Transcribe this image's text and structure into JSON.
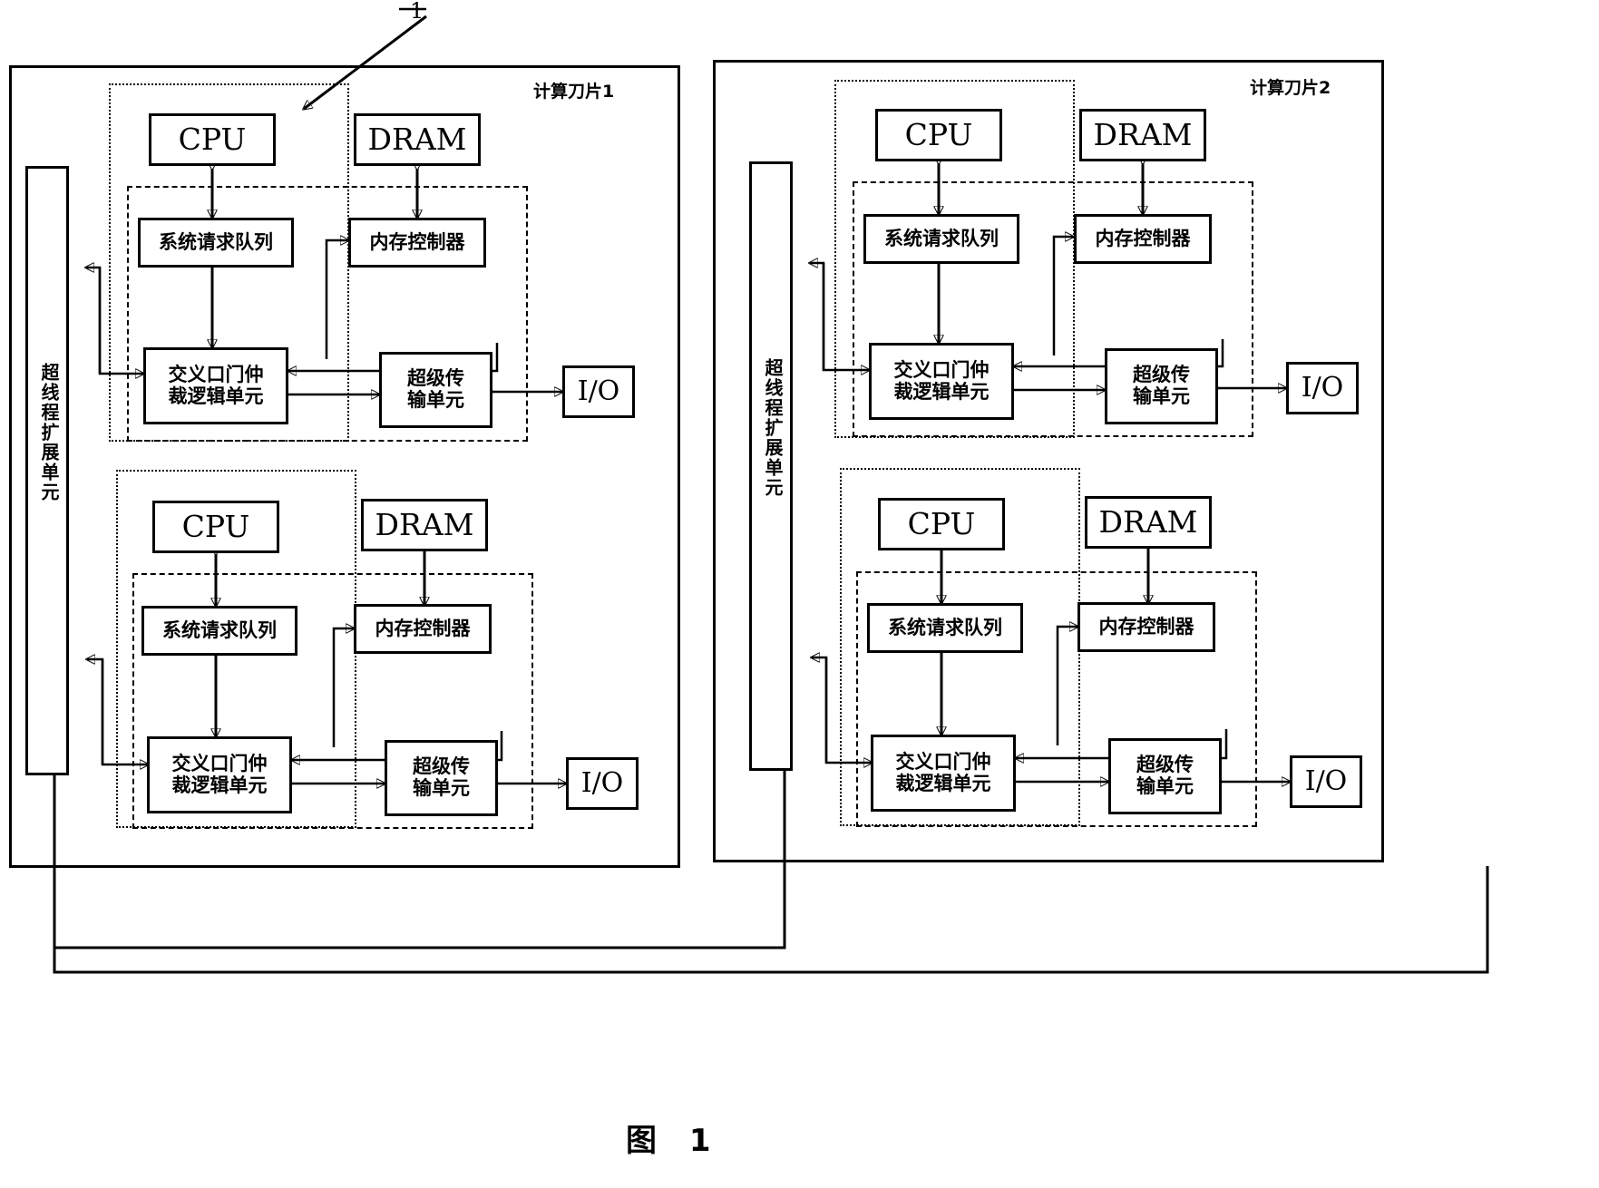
{
  "figure": {
    "caption": "图  1",
    "callout_number": "1"
  },
  "blades": [
    {
      "id": "blade-1",
      "label": "计算刀片1",
      "hyperthread_unit": "超线程扩展单元",
      "nodes": [
        {
          "id": "node-1",
          "cpu": "CPU",
          "dram": "DRAM",
          "request_queue": "系统请求队列",
          "memory_controller": "内存控制器",
          "crossbar": "交叉口门仲裁逻辑单元",
          "hypertransport": "超级传输单元",
          "io": "I/O"
        },
        {
          "id": "node-2",
          "cpu": "CPU",
          "dram": "DRAM",
          "request_queue": "系统请求队列",
          "memory_controller": "内存控制器",
          "crossbar": "交叉口门仲裁逻辑单元",
          "hypertransport": "超级传输单元",
          "io": "I/O"
        }
      ]
    },
    {
      "id": "blade-2",
      "label": "计算刀片2",
      "hyperthread_unit": "超线程扩展单元",
      "nodes": [
        {
          "id": "node-1",
          "cpu": "CPU",
          "dram": "DRAM",
          "request_queue": "系统请求队列",
          "memory_controller": "内存控制器",
          "crossbar": "交叉口门仲裁逻辑单元",
          "hypertransport": "超级传输单元",
          "io": "I/O"
        },
        {
          "id": "node-2",
          "cpu": "CPU",
          "dram": "DRAM",
          "request_queue": "系统请求队列",
          "memory_controller": "内存控制器",
          "crossbar": "交叉口门仲裁逻辑单元",
          "hypertransport": "超级传输单元",
          "io": "I/O"
        }
      ]
    }
  ],
  "crossbar_lines": {
    "line1": "交义口门仲",
    "line2": "裁逻辑单元"
  },
  "hypertransport_lines": {
    "line1": "超级传",
    "line2": "输单元"
  },
  "hyperthread_chars": "超线程扩展单元",
  "colors": {
    "ink": "#000000",
    "paper": "#ffffff"
  }
}
